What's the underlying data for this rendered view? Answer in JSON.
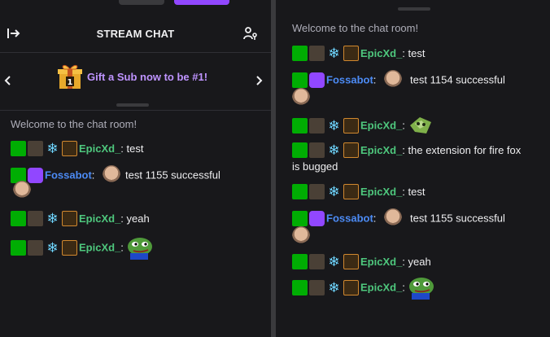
{
  "left": {
    "header_title": "STREAM CHAT",
    "gift_text": "Gift a Sub now to be #1!",
    "welcome": "Welcome to the chat room!",
    "messages": [
      {
        "user": "EpicXd_",
        "text": ": test"
      },
      {
        "user": "Fossabot",
        "text": ":",
        "after_face": "test 1155 successful"
      },
      {
        "user": "EpicXd_",
        "text": ": yeah"
      },
      {
        "user": "EpicXd_",
        "text": ":"
      }
    ]
  },
  "right": {
    "welcome": "Welcome to the chat room!",
    "messages": [
      {
        "user": "EpicXd_",
        "text": ": test"
      },
      {
        "user": "Fossabot",
        "text": ":",
        "after_face": "test 1154 successful"
      },
      {
        "user": "EpicXd_",
        "text": ":"
      },
      {
        "user": "EpicXd_",
        "text": ": the extension for fire fox",
        "wrap": "is bugged"
      },
      {
        "user": "EpicXd_",
        "text": ": test"
      },
      {
        "user": "Fossabot",
        "text": ":",
        "after_face": "test 1155 successful"
      },
      {
        "user": "EpicXd_",
        "text": ": yeah"
      },
      {
        "user": "EpicXd_",
        "text": ":"
      }
    ]
  },
  "colors": {
    "accent": "#9147ff",
    "gift_text": "#bf94ff",
    "name_green": "#4ec77d",
    "name_blue": "#4c8bf5",
    "mod_badge": "#00ad03"
  }
}
